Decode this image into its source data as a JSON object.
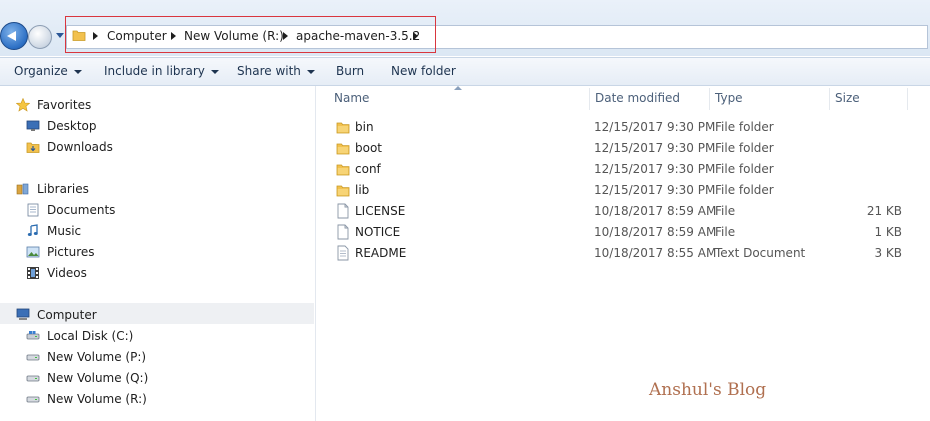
{
  "address": {
    "crumbs": [
      "Computer",
      "New Volume (R:)",
      "apache-maven-3.5.2"
    ]
  },
  "toolbar": {
    "organize": "Organize",
    "include_in_library": "Include in library",
    "share_with": "Share with",
    "burn": "Burn",
    "new_folder": "New folder"
  },
  "nav": {
    "favorites": "Favorites",
    "desktop": "Desktop",
    "downloads": "Downloads",
    "libraries": "Libraries",
    "documents": "Documents",
    "music": "Music",
    "pictures": "Pictures",
    "videos": "Videos",
    "computer": "Computer",
    "local_disk": "Local Disk (C:)",
    "vol_p": "New Volume (P:)",
    "vol_q": "New Volume (Q:)",
    "vol_r": "New Volume (R:)"
  },
  "columns": {
    "name": "Name",
    "date": "Date modified",
    "type": "Type",
    "size": "Size"
  },
  "files": [
    {
      "name": "bin",
      "date": "12/15/2017 9:30 PM",
      "type": "File folder",
      "size": "",
      "kind": "folder"
    },
    {
      "name": "boot",
      "date": "12/15/2017 9:30 PM",
      "type": "File folder",
      "size": "",
      "kind": "folder"
    },
    {
      "name": "conf",
      "date": "12/15/2017 9:30 PM",
      "type": "File folder",
      "size": "",
      "kind": "folder"
    },
    {
      "name": "lib",
      "date": "12/15/2017 9:30 PM",
      "type": "File folder",
      "size": "",
      "kind": "folder"
    },
    {
      "name": "LICENSE",
      "date": "10/18/2017 8:59 AM",
      "type": "File",
      "size": "21 KB",
      "kind": "file"
    },
    {
      "name": "NOTICE",
      "date": "10/18/2017 8:59 AM",
      "type": "File",
      "size": "1 KB",
      "kind": "file"
    },
    {
      "name": "README",
      "date": "10/18/2017 8:55 AM",
      "type": "Text Document",
      "size": "3 KB",
      "kind": "file"
    }
  ],
  "watermark": "Anshul's Blog",
  "colors": {
    "folder": "#f2c14e",
    "highlight_box": "#d9363e",
    "watermark": "#b07050"
  }
}
